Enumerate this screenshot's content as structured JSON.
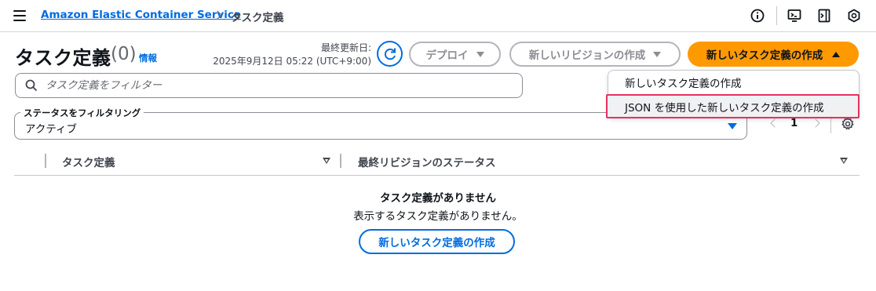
{
  "breadcrumb": {
    "service": "Amazon Elastic Container Service",
    "current": "タスク定義"
  },
  "header": {
    "title": "タスク定義",
    "count": "(0)",
    "info": "情報",
    "updated_label": "最終更新日:",
    "updated_time": "2025年9月12日 05:22 (UTC+9:00)"
  },
  "actions": {
    "deploy": "デプロイ",
    "new_revision": "新しいリビジョンの作成",
    "create": "新しいタスク定義の作成"
  },
  "menu": {
    "items": [
      "新しいタスク定義の作成",
      "JSON を使用した新しいタスク定義の作成"
    ]
  },
  "search": {
    "placeholder": "タスク定義をフィルター"
  },
  "status_filter": {
    "label": "ステータスをフィルタリング",
    "value": "アクティブ"
  },
  "pagination": {
    "page": "1"
  },
  "table": {
    "columns": [
      "タスク定義",
      "最終リビジョンのステータス"
    ]
  },
  "empty": {
    "title": "タスク定義がありません",
    "description": "表示するタスク定義がありません。",
    "button": "新しいタスク定義の作成"
  },
  "colors": {
    "primary": "#ff9900",
    "link": "#006ce0",
    "highlight_border": "#e8305f"
  }
}
